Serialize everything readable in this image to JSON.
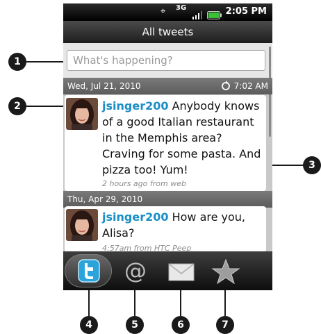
{
  "status_bar": {
    "time": "2:05 PM",
    "network": "3G"
  },
  "title": "All tweets",
  "compose": {
    "placeholder": "What's happening?"
  },
  "timeline": [
    {
      "date": "Wed, Jul 21, 2010",
      "time": "7:02 AM",
      "user": "jsinger200",
      "text": " Anybody knows of a good Italian restaurant in the Memphis area? Craving for some pasta. And pizza too! Yum!",
      "meta": "2 hours ago from web"
    },
    {
      "date": "Thu, Apr 29, 2010",
      "user": "jsinger200",
      "text": " How are you, Alisa?",
      "meta": "4:57am from HTC Peep"
    }
  ],
  "tabs": [
    {
      "name": "tweets",
      "icon": "twitter-bird-icon",
      "selected": true
    },
    {
      "name": "mentions",
      "icon": "at-sign-icon"
    },
    {
      "name": "direct-messages",
      "icon": "envelope-icon"
    },
    {
      "name": "favorites",
      "icon": "star-icon"
    }
  ],
  "callouts": [
    "1",
    "2",
    "3",
    "4",
    "5",
    "6",
    "7"
  ],
  "colors": {
    "username": "#1a8fc6",
    "twitter_blue": "#2ba4dc"
  }
}
